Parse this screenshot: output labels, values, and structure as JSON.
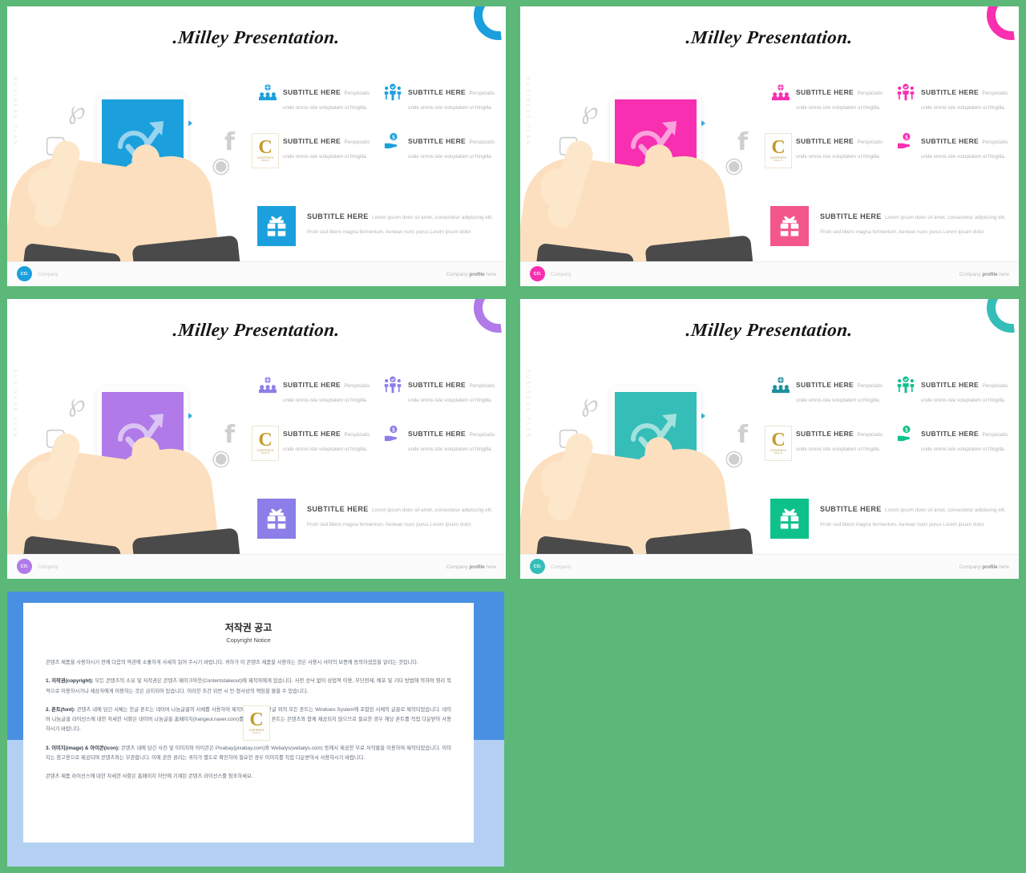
{
  "background_color": "#5cb878",
  "slides": [
    {
      "id": "slide-blue",
      "accent": "#1ca0dd",
      "accent_soft": "#2aa9e0",
      "title": ".Milley Presentation.",
      "vertical_text": "BUSINESS PLAN",
      "features": [
        {
          "icon": "global-team-icon",
          "title": "SUBTITLE HERE",
          "desc": "Perspiciatis unde omnis iste voluptatem ut fringilla."
        },
        {
          "icon": "verified-team-icon",
          "title": "SUBTITLE HERE",
          "desc": "Perspiciatis unde omnis iste voluptatem ut fringilla."
        },
        {
          "icon": "money-bag-icon",
          "title": "SUBTITLE HERE",
          "desc": "Perspiciatis unde omnis iste voluptatem ut fringilla."
        },
        {
          "icon": "hand-coin-icon",
          "title": "SUBTITLE HERE",
          "desc": "Perspiciatis unde omnis iste voluptatem ut fringilla."
        }
      ],
      "wide_feature": {
        "icon": "gift-box-icon",
        "title": "SUBTITLE HERE",
        "desc": "Lorem ipsum dolor sit amet, consectetur adipiscing elit. Proin sed libero magna fermentum. Aenean nunc purus Lorem ipsum dolor"
      },
      "logo_text": "CO.",
      "footer_left": "Company",
      "footer_right_pre": "Company ",
      "footer_right_bold": "profile",
      "footer_right_post": " here"
    },
    {
      "id": "slide-pink",
      "accent": "#f72fb0",
      "accent_soft": "#f2568b",
      "title": ".Milley Presentation.",
      "vertical_text": "BUSINESS PLAN",
      "features": [
        {
          "icon": "global-team-icon",
          "title": "SUBTITLE HERE",
          "desc": "Perspiciatis unde omnis iste voluptatem ut fringilla."
        },
        {
          "icon": "verified-team-icon",
          "title": "SUBTITLE HERE",
          "desc": "Perspiciatis unde omnis iste voluptatem ut fringilla."
        },
        {
          "icon": "money-bag-icon",
          "title": "SUBTITLE HERE",
          "desc": "Perspiciatis unde omnis iste voluptatem ut fringilla."
        },
        {
          "icon": "hand-coin-icon",
          "title": "SUBTITLE HERE",
          "desc": "Perspiciatis unde omnis iste voluptatem ut fringilla."
        }
      ],
      "wide_feature": {
        "icon": "gift-box-icon",
        "title": "SUBTITLE HERE",
        "desc": "Lorem ipsum dolor sit amet, consectetur adipiscing elit. Proin sed libero magna fermentum. Aenean nunc purus Lorem ipsum dolor"
      },
      "logo_text": "CO.",
      "footer_left": "Company",
      "footer_right_pre": "Company ",
      "footer_right_bold": "profile",
      "footer_right_post": " here"
    },
    {
      "id": "slide-purple",
      "accent": "#b07ae8",
      "accent_soft": "#8b7ee8",
      "title": ".Milley Presentation.",
      "vertical_text": "BUSINESS PLAN",
      "features": [
        {
          "icon": "global-team-icon",
          "title": "SUBTITLE HERE",
          "desc": "Perspiciatis unde omnis iste voluptatem ut fringilla."
        },
        {
          "icon": "verified-team-icon",
          "title": "SUBTITLE HERE",
          "desc": "Perspiciatis unde omnis iste voluptatem ut fringilla."
        },
        {
          "icon": "money-bag-icon",
          "title": "SUBTITLE HERE",
          "desc": "Perspiciatis unde omnis iste voluptatem ut fringilla."
        },
        {
          "icon": "hand-coin-icon",
          "title": "SUBTITLE HERE",
          "desc": "Perspiciatis unde omnis iste voluptatem ut fringilla."
        }
      ],
      "wide_feature": {
        "icon": "gift-box-icon",
        "title": "SUBTITLE HERE",
        "desc": "Lorem ipsum dolor sit amet, consectetur adipiscing elit. Proin sed libero magna fermentum. Aenean nunc purus Lorem ipsum dolor"
      },
      "logo_text": "CO.",
      "footer_left": "Company",
      "footer_right_pre": "Company ",
      "footer_right_bold": "profile",
      "footer_right_post": " here"
    },
    {
      "id": "slide-teal",
      "accent": "#35bdb8",
      "accent_soft": "#0ec18a",
      "title": ".Milley Presentation.",
      "vertical_text": "BUSINESS PLAN",
      "features": [
        {
          "icon": "global-team-icon",
          "title": "SUBTITLE HERE",
          "desc": "Perspiciatis unde omnis iste voluptatem ut fringilla."
        },
        {
          "icon": "verified-team-icon",
          "title": "SUBTITLE HERE",
          "desc": "Perspiciatis unde omnis iste voluptatem ut fringilla."
        },
        {
          "icon": "money-bag-icon",
          "title": "SUBTITLE HERE",
          "desc": "Perspiciatis unde omnis iste voluptatem ut fringilla."
        },
        {
          "icon": "hand-coin-icon",
          "title": "SUBTITLE HERE",
          "desc": "Perspiciatis unde omnis iste voluptatem ut fringilla."
        }
      ],
      "wide_feature": {
        "icon": "gift-box-icon",
        "title": "SUBTITLE HERE",
        "desc": "Lorem ipsum dolor sit amet, consectetur adipiscing elit. Proin sed libero magna fermentum. Aenean nunc purus Lorem ipsum dolor"
      },
      "logo_text": "CO.",
      "footer_left": "Company",
      "footer_right_pre": "Company ",
      "footer_right_bold": "profile",
      "footer_right_post": " here"
    }
  ],
  "copyright_slide": {
    "id": "slide-copyright",
    "border_color": "#4a90e2",
    "title": "저작권 공고",
    "subtitle": "Copyright Notice",
    "intro": "콘텐츠 제품을 사용하시기 전에 다음의 약관에 소홀하게 사세히 읽어 주시기 바랍니다. 귀하가 이 콘텐츠 제품을 사용하는 것은 사용시 사이의 보증에 동의하셨음을 알리는 것입니다.",
    "items": [
      {
        "heading": "1. 저작권(copyright):",
        "body": " 모든 콘텐츠의 소유 및 저작권은 콘텐츠 메이크아웃(Contentstakeout)에 제작자에게 있습니다. 사전 승낙 없이 상업적 이용, 무단전재, 배포 및 기타 방법에 의하여 영리 목적으로 이용하시거나 제삼자에게 이용하는 것은 금지되어 있습니다. 이러한 조건 위반 시 민·형사상의 책임을 물을 수 있습니다."
      },
      {
        "heading": "2. 폰트(font):",
        "body": " 콘텐츠 내에 담긴 서체는 한글 폰트는 네이버 나눔글꼴의 서체를 사용하여 제작되었습니다. 한글 외의 모든 폰트는 Windows System에 포함된 서체의 글꼴로 제작되었습니다. 네이버 나눔글꼴 라이선스에 대한 자세한 사항은 네이버 나눔글꼴 홈페이지(hangeul.naver.com)를 참조하세요. 폰트는 콘텐츠와 함께 제공되지 않으므로 필요한 경우 해당 폰트를 직접 다운받아 사용하시기 바랍니다."
      },
      {
        "heading": "3. 이미지(image) & 아이콘(icon):",
        "body": " 콘텐츠 내에 담긴 사진 및 이미지와 아이콘은 Pixabay(pixabay.com)와 Webalys(webalys.com) 등에서 제공한 무료 저작물을 이용하여 제작되었습니다. 이미지는 참고용으로 제공되며 콘텐츠와는 무관합니다. 이에 관한 권리는 귀하가 별도로 확인하여 필요한 경우 이미지를 직접 다운받아서 사용하시기 바랍니다."
      }
    ],
    "outro": "콘텐츠 제품 라이선스에 대한 자세한 사항은 홈페이지 하단에 기재된 콘텐츠 라이선스를 참조하세요."
  }
}
